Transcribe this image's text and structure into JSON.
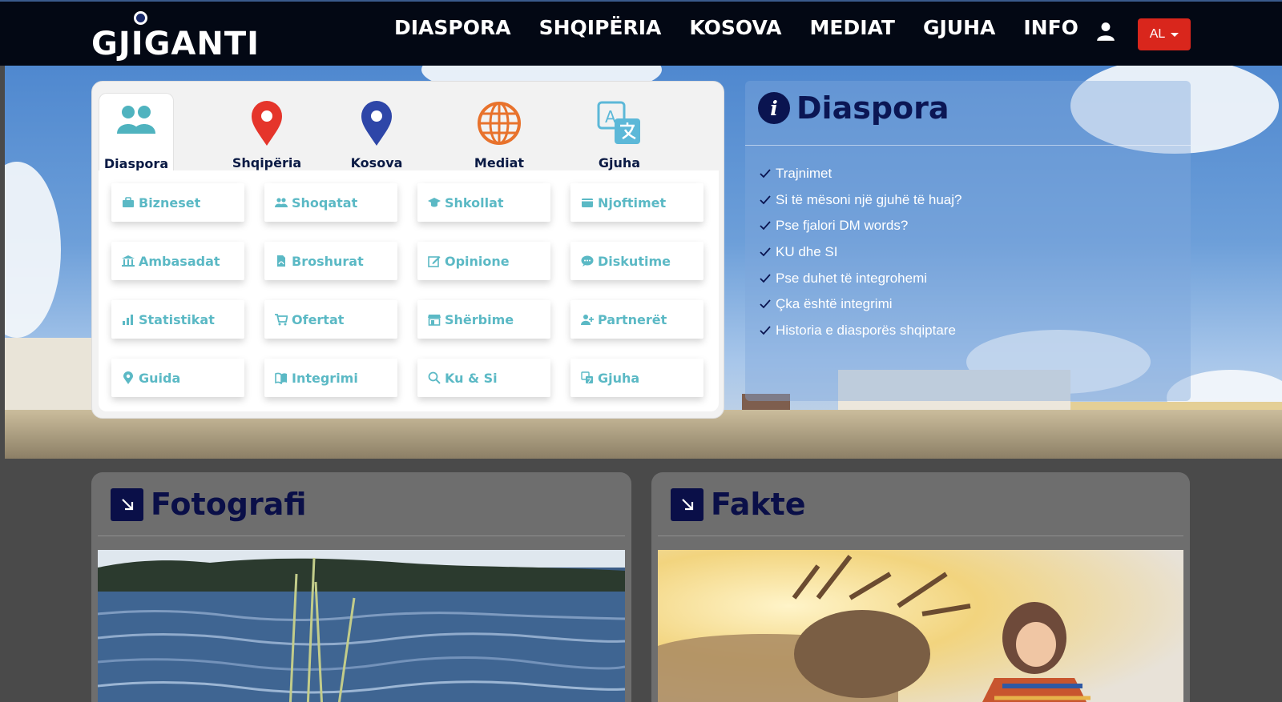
{
  "header": {
    "logo_text": "GJIGANTI",
    "nav": [
      "DIASPORA",
      "SHQIPËRIA",
      "KOSOVA",
      "MEDIAT",
      "GJUHA",
      "INFO"
    ],
    "user_icon": "user-icon",
    "lang_label": "AL"
  },
  "categories": {
    "tabs": [
      {
        "label": "Diaspora",
        "icon": "users-icon",
        "active": true
      },
      {
        "label": "Shqipëria",
        "icon": "map-pin-red-icon"
      },
      {
        "label": "Kosova",
        "icon": "map-pin-blue-icon"
      },
      {
        "label": "Mediat",
        "icon": "globe-icon"
      },
      {
        "label": "Gjuha",
        "icon": "translate-icon"
      }
    ],
    "items": [
      {
        "label": "Bizneset",
        "icon": "briefcase-icon"
      },
      {
        "label": "Shoqatat",
        "icon": "users-icon"
      },
      {
        "label": "Shkollat",
        "icon": "graduation-cap-icon"
      },
      {
        "label": "Njoftimet",
        "icon": "wallet-icon"
      },
      {
        "label": "Ambasadat",
        "icon": "bank-icon"
      },
      {
        "label": "Broshurat",
        "icon": "pdf-file-icon"
      },
      {
        "label": "Opinione",
        "icon": "edit-icon"
      },
      {
        "label": "Diskutime",
        "icon": "chat-icon"
      },
      {
        "label": "Statistikat",
        "icon": "bar-chart-icon"
      },
      {
        "label": "Ofertat",
        "icon": "cart-icon"
      },
      {
        "label": "Shërbime",
        "icon": "store-icon"
      },
      {
        "label": "Partnerët",
        "icon": "user-plus-icon"
      },
      {
        "label": "Guida",
        "icon": "map-marker-icon"
      },
      {
        "label": "Integrimi",
        "icon": "book-icon"
      },
      {
        "label": "Ku & Si",
        "icon": "search-icon"
      },
      {
        "label": "Gjuha",
        "icon": "translate-icon"
      }
    ]
  },
  "info": {
    "title": "Diaspora",
    "icon": "info-icon",
    "items": [
      "Trajnimet",
      "Si të mësoni një gjuhë të huaj?",
      "Pse fjalori DM words?",
      "KU dhe SI",
      "Pse duhet të integrohemi",
      "Çka është integrimi",
      "Historia e diasporës shqiptare"
    ]
  },
  "cards": [
    {
      "title": "Fotografi",
      "icon": "arrow-down-right-icon"
    },
    {
      "title": "Fakte",
      "icon": "arrow-down-right-icon"
    }
  ],
  "colors": {
    "topbar_bg": "#030814",
    "accent_red": "#d9261c",
    "item_teal": "#5bb9c5",
    "navy": "#0a0f48"
  }
}
